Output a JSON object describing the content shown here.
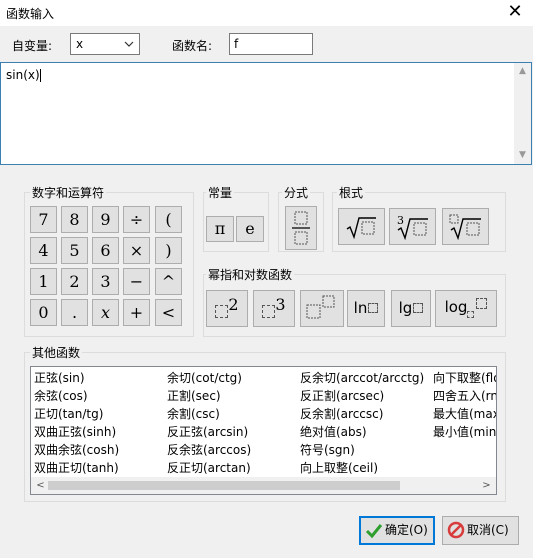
{
  "window": {
    "title": "函数输入",
    "close_icon": "close-icon"
  },
  "form": {
    "var_label": "自变量:",
    "var_value": "x",
    "fname_label": "函数名:",
    "fname_value": "f"
  },
  "editor": {
    "text": "sin(x)"
  },
  "groups": {
    "numbers": "数字和运算符",
    "constants": "常量",
    "fraction": "分式",
    "roots": "根式",
    "powers": "幂指和对数函数",
    "others": "其他函数"
  },
  "keys": {
    "row1": [
      "7",
      "8",
      "9",
      "÷",
      "("
    ],
    "row2": [
      "4",
      "5",
      "6",
      "×",
      ")"
    ],
    "row3": [
      "1",
      "2",
      "3",
      "−",
      "^"
    ],
    "row4": [
      "0",
      ".",
      "x",
      "+",
      "<"
    ]
  },
  "constants": [
    "π",
    "e"
  ],
  "roots": {
    "cube_index": "3"
  },
  "powers": {
    "square_exp": "2",
    "cube_exp": "3",
    "ln": "ln",
    "lg": "lg",
    "log": "log"
  },
  "functions": {
    "col1": [
      "正弦(sin)",
      "余弦(cos)",
      "正切(tan/tg)",
      "双曲正弦(sinh)",
      "双曲余弦(cosh)",
      "双曲正切(tanh)"
    ],
    "col2": [
      "余切(cot/ctg)",
      "正割(sec)",
      "余割(csc)",
      "反正弦(arcsin)",
      "反余弦(arccos)",
      "反正切(arctan)"
    ],
    "col3": [
      "反余切(arccot/arcctg)",
      "反正割(arcsec)",
      "反余割(arccsc)",
      "绝对值(abs)",
      "符号(sgn)",
      "向上取整(ceil)"
    ],
    "col4": [
      "向下取整(flo",
      "四舍五入(rn",
      "最大值(max",
      "最小值(min)"
    ]
  },
  "buttons": {
    "ok": "确定(O)",
    "cancel": "取消(C)"
  },
  "colors": {
    "ok_check": "#2e9e2e",
    "cancel_icon": "#d83b3b",
    "focus": "#0078d7"
  }
}
